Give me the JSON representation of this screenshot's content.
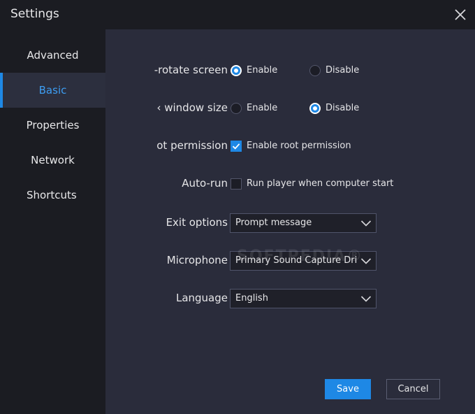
{
  "window": {
    "title": "Settings"
  },
  "sidebar": {
    "items": [
      {
        "label": "Advanced",
        "active": false
      },
      {
        "label": "Basic",
        "active": true
      },
      {
        "label": "Properties",
        "active": false
      },
      {
        "label": "Network",
        "active": false
      },
      {
        "label": "Shortcuts",
        "active": false
      }
    ]
  },
  "settings": {
    "auto_rotate": {
      "label": "-rotate screen",
      "options": [
        "Enable",
        "Disable"
      ],
      "selected": "Enable"
    },
    "lock_window": {
      "label": "‹ window size",
      "options": [
        "Enable",
        "Disable"
      ],
      "selected": "Disable"
    },
    "root": {
      "label": "ot permission",
      "checkbox_label": "Enable root permission",
      "checked": true
    },
    "autorun": {
      "label": "Auto-run",
      "checkbox_label": "Run player when computer start",
      "checked": false
    },
    "exit_options": {
      "label": "Exit options",
      "value": "Prompt message"
    },
    "microphone": {
      "label": "Microphone",
      "value": "Primary Sound Capture Driver"
    },
    "language": {
      "label": "Language",
      "value": "English"
    }
  },
  "watermark": "SOFTPEDIA®",
  "buttons": {
    "save": "Save",
    "cancel": "Cancel"
  },
  "colors": {
    "accent": "#1e88e5",
    "active_nav_text": "#3d9df2",
    "content_bg": "#2a2c3b",
    "sidebar_bg": "#1b1c22"
  }
}
